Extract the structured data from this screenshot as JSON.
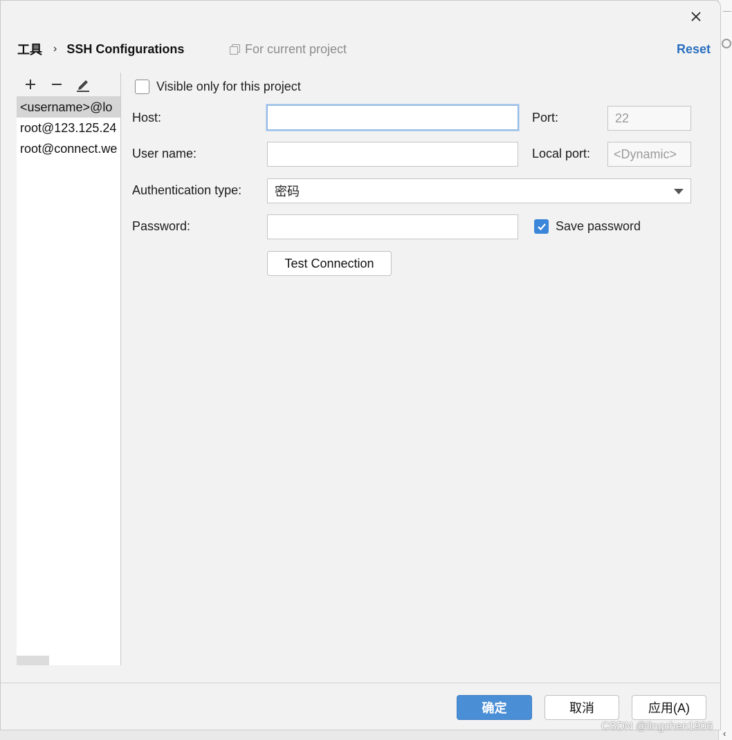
{
  "header": {
    "breadcrumb_root": "工具",
    "breadcrumb_sep": "›",
    "breadcrumb_page": "SSH Configurations",
    "scope": "For current project",
    "reset": "Reset"
  },
  "list": {
    "items": [
      {
        "label": "<username>@lo",
        "selected": true
      },
      {
        "label": "root@123.125.24",
        "selected": false
      },
      {
        "label": "root@connect.we",
        "selected": false
      }
    ],
    "toolbar_icons": [
      "add-icon",
      "remove-icon",
      "edit-icon"
    ]
  },
  "form": {
    "visible_only_label": "Visible only for this project",
    "visible_only_checked": false,
    "host_label": "Host:",
    "host_value": "",
    "port_label": "Port:",
    "port_value": "22",
    "username_label": "User name:",
    "username_value": "",
    "local_port_label": "Local port:",
    "local_port_placeholder": "<Dynamic>",
    "auth_type_label": "Authentication type:",
    "auth_type_value": "密码",
    "password_label": "Password:",
    "password_value": "",
    "save_password_label": "Save password",
    "save_password_checked": true,
    "test_connection": "Test Connection"
  },
  "footer": {
    "ok": "确定",
    "cancel": "取消",
    "apply": "应用(A)"
  },
  "watermark": "CSDN @lingchen1906",
  "colors": {
    "accent": "#4a8ed6",
    "link": "#2a6fc0",
    "checkbox_checked": "#3c86d9",
    "focus_border": "#96bbe6"
  }
}
